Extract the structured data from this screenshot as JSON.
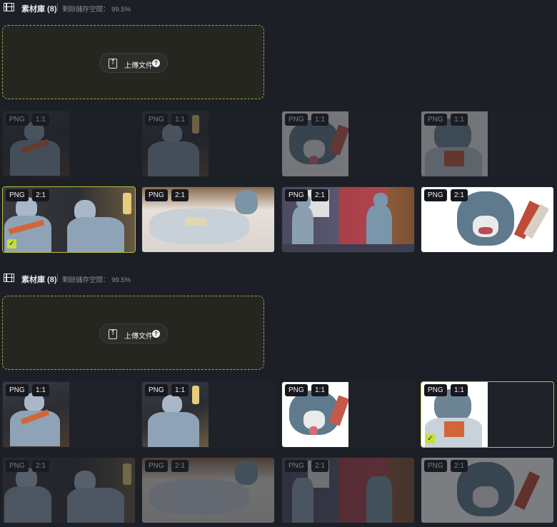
{
  "sections": [
    {
      "library_title": "素材庫 (8)",
      "storage_text": "剩餘儲存空間： 99.5%",
      "upload_label": "上傳文件",
      "help_icon": "?",
      "cards": [
        {
          "format": "PNG",
          "ratio": "1:1",
          "state": "dim"
        },
        {
          "format": "PNG",
          "ratio": "1:1",
          "state": "dim"
        },
        {
          "format": "PNG",
          "ratio": "1:1",
          "state": "dim"
        },
        {
          "format": "PNG",
          "ratio": "1:1",
          "state": "dim"
        },
        {
          "format": "PNG",
          "ratio": "2:1",
          "state": "selected"
        },
        {
          "format": "PNG",
          "ratio": "2:1",
          "state": "normal"
        },
        {
          "format": "PNG",
          "ratio": "2:1",
          "state": "normal"
        },
        {
          "format": "PNG",
          "ratio": "2:1",
          "state": "normal"
        }
      ]
    },
    {
      "library_title": "素材庫 (8)",
      "storage_text": "剩餘儲存空間： 99.5%",
      "upload_label": "上傳文件",
      "help_icon": "?",
      "cards": [
        {
          "format": "PNG",
          "ratio": "1:1",
          "state": "normal"
        },
        {
          "format": "PNG",
          "ratio": "1:1",
          "state": "normal"
        },
        {
          "format": "PNG",
          "ratio": "1:1",
          "state": "normal"
        },
        {
          "format": "PNG",
          "ratio": "1:1",
          "state": "selected"
        },
        {
          "format": "PNG",
          "ratio": "2:1",
          "state": "dim"
        },
        {
          "format": "PNG",
          "ratio": "2:1",
          "state": "dim"
        },
        {
          "format": "PNG",
          "ratio": "2:1",
          "state": "dim"
        },
        {
          "format": "PNG",
          "ratio": "2:1",
          "state": "dim"
        }
      ]
    }
  ],
  "colors": {
    "background": "#1c1f26",
    "upload_border": "#a8a63a",
    "selected_border": "#b6bf3e",
    "check_fill": "#c8df3a"
  },
  "icons": {
    "library": "film-strip-icon",
    "upload": "upload-file-icon",
    "help": "help-circle-icon",
    "check": "checkmark-icon"
  }
}
